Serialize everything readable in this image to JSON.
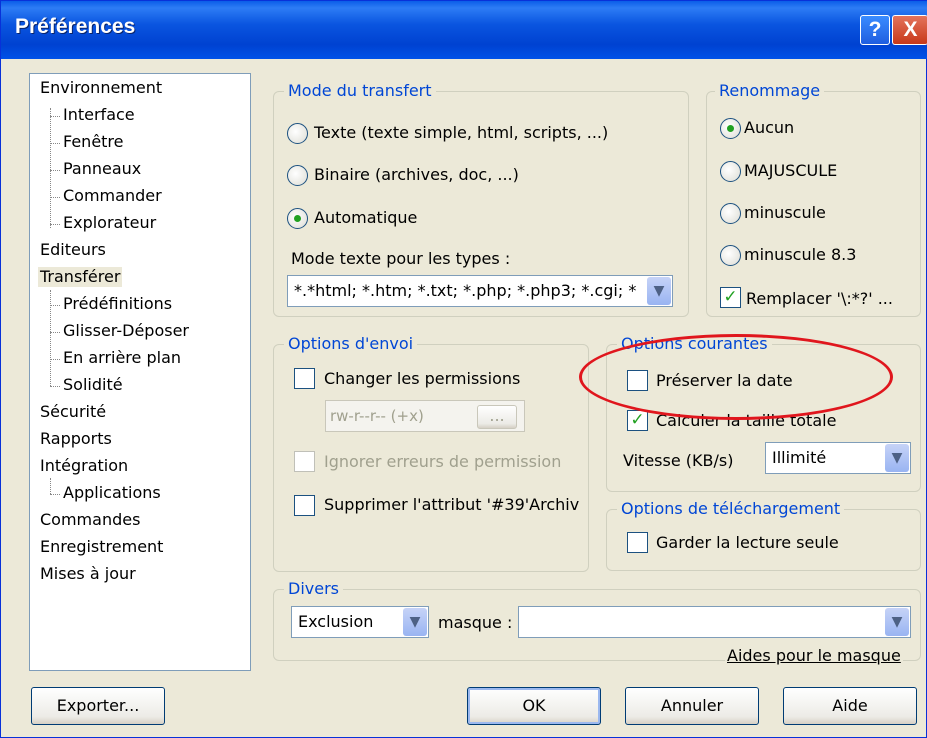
{
  "window": {
    "title": "Préférences",
    "help_button": "?",
    "close_button": "X"
  },
  "tree": {
    "items": [
      {
        "label": "Environnement",
        "level": 0
      },
      {
        "label": "Interface",
        "level": 1
      },
      {
        "label": "Fenêtre",
        "level": 1
      },
      {
        "label": "Panneaux",
        "level": 1
      },
      {
        "label": "Commander",
        "level": 1
      },
      {
        "label": "Explorateur",
        "level": 1
      },
      {
        "label": "Editeurs",
        "level": 0
      },
      {
        "label": "Transférer",
        "level": 0,
        "selected": true
      },
      {
        "label": "Prédéfinitions",
        "level": 1
      },
      {
        "label": "Glisser-Déposer",
        "level": 1
      },
      {
        "label": "En arrière plan",
        "level": 1
      },
      {
        "label": "Solidité",
        "level": 1
      },
      {
        "label": "Sécurité",
        "level": 0
      },
      {
        "label": "Rapports",
        "level": 0
      },
      {
        "label": "Intégration",
        "level": 0
      },
      {
        "label": "Applications",
        "level": 1
      },
      {
        "label": "Commandes",
        "level": 0
      },
      {
        "label": "Enregistrement",
        "level": 0
      },
      {
        "label": "Mises à jour",
        "level": 0
      }
    ]
  },
  "transfer_mode": {
    "title": "Mode du transfert",
    "options": [
      {
        "label": "Texte (texte simple, html, scripts, ...)",
        "checked": false
      },
      {
        "label": "Binaire (archives, doc, ...)",
        "checked": false
      },
      {
        "label": "Automatique",
        "checked": true
      }
    ],
    "types_label": "Mode texte pour les types :",
    "types_value": "*.*html; *.htm; *.txt; *.php; *.php3; *.cgi; *"
  },
  "rename": {
    "title": "Renommage",
    "options": [
      {
        "label": "Aucun",
        "checked": true
      },
      {
        "label": "MAJUSCULE",
        "checked": false
      },
      {
        "label": "minuscule",
        "checked": false
      },
      {
        "label": "minuscule 8.3",
        "checked": false
      }
    ],
    "replace_label": "Remplacer '\\:*?' ...",
    "replace_checked": true
  },
  "upload_options": {
    "title": "Options d'envoi",
    "change_permissions": "Changer les permissions",
    "permissions_value": "rw-r--r-- (+x)",
    "permissions_button": "...",
    "ignore_errors": "Ignorer erreurs de permission",
    "remove_archive": "Supprimer l'attribut '#39'Archiv"
  },
  "current_options": {
    "title": "Options courantes",
    "preserve_date": "Préserver la date",
    "preserve_date_checked": false,
    "calc_size": "Calculer la taille totale",
    "calc_size_checked": true,
    "speed_label": "Vitesse (KB/s)",
    "speed_value": "Illimité"
  },
  "download_options": {
    "title": "Options de téléchargement",
    "read_only": "Garder la lecture seule",
    "read_only_checked": false
  },
  "misc": {
    "title": "Divers",
    "filter_mode": "Exclusion",
    "mask_label": "masque :",
    "mask_value": "",
    "mask_help_link": "Aides pour le masque"
  },
  "buttons": {
    "export": "Exporter...",
    "ok": "OK",
    "cancel": "Annuler",
    "help": "Aide"
  },
  "icons": {
    "dropdown": "chevron-down-icon",
    "check": "checkmark-icon"
  },
  "colors": {
    "titlebar": "#0a55e0",
    "group_title": "#0046d5",
    "annotation": "#e0161d",
    "dialog_bg": "#ece9d8"
  }
}
